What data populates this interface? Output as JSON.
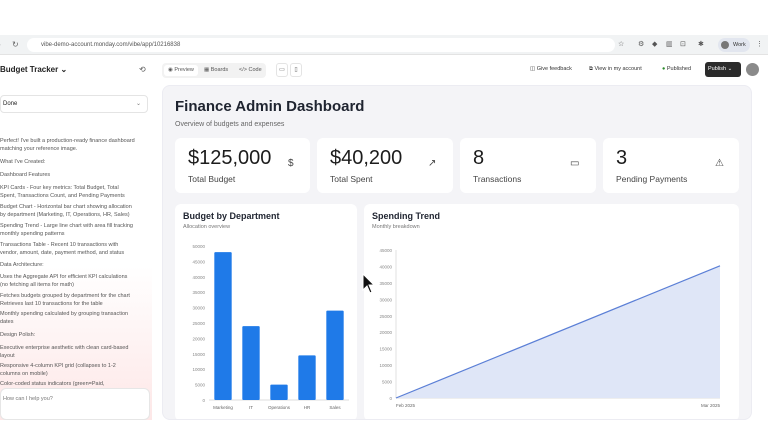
{
  "browser": {
    "url": "vibe-demo-account.monday.com/vibe/app/10216838",
    "profile": "Work"
  },
  "sidebar": {
    "title": "Budget Tracker",
    "status": "Done",
    "lines": [
      "Perfect! I've built a production-ready finance dashboard",
      "matching your reference image.",
      "What I've Created:",
      "Dashboard Features",
      "KPI Cards - Four key metrics: Total Budget, Total",
      "Spent, Transactions Count, and Pending Payments",
      "Budget Chart - Horizontal bar chart showing allocation",
      "by department (Marketing, IT, Operations, HR, Sales)",
      "Spending Trend - Large line chart with area fill tracking",
      "monthly spending patterns",
      "Transactions Table - Recent 10 transactions with",
      "vendor, amount, date, payment method, and status",
      "Data Architecture:",
      "Uses the Aggregate API for efficient KPI calculations",
      "(no fetching all items for math)",
      "Fetches budgets grouped by department for the chart",
      "Retrieves last 10 transactions for the table",
      "Monthly spending calculated by grouping transaction",
      "dates",
      "Design Polish:",
      "Executive enterprise aesthetic with clean card-based",
      "layout",
      "Responsive 4-column KPI grid (collapses to 1-2",
      "columns on mobile)",
      "Color-coded status indicators (green=Paid,"
    ],
    "chat_placeholder": "How can I help you?"
  },
  "toolbar": {
    "tabs": [
      "Preview",
      "Boards",
      "Code"
    ],
    "give_feedback": "Give feedback",
    "view_account": "View in my account",
    "published": "Published",
    "publish": "Publish"
  },
  "dashboard": {
    "title": "Finance Admin Dashboard",
    "subtitle": "Overview of budgets and expenses",
    "kpis": [
      {
        "value": "$125,000",
        "label": "Total Budget",
        "icon": "dollar-icon"
      },
      {
        "value": "$40,200",
        "label": "Total Spent",
        "icon": "trend-up-icon"
      },
      {
        "value": "8",
        "label": "Transactions",
        "icon": "card-icon"
      },
      {
        "value": "3",
        "label": "Pending Payments",
        "icon": "warning-icon"
      }
    ],
    "budget_chart": {
      "title": "Budget by Department",
      "subtitle": "Allocation overview"
    },
    "trend_chart": {
      "title": "Spending Trend",
      "subtitle": "Monthly breakdown"
    }
  },
  "chart_data": [
    {
      "type": "bar",
      "title": "Budget by Department",
      "categories": [
        "Marketing",
        "IT",
        "Operations",
        "HR",
        "Sales"
      ],
      "values": [
        48000,
        24000,
        5000,
        14500,
        29000
      ],
      "ylim": [
        0,
        50000
      ],
      "yticks": [
        "0",
        "5000",
        "10000",
        "15000",
        "20000",
        "25000",
        "30000",
        "35000",
        "40000",
        "45000",
        "50000"
      ],
      "color": "#1f7ae8"
    },
    {
      "type": "area",
      "title": "Spending Trend",
      "categories": [
        "Feb 2025",
        "Mar 2025"
      ],
      "values": [
        0,
        40200
      ],
      "ylim": [
        0,
        45000
      ],
      "yticks": [
        "0",
        "5000",
        "10000",
        "15000",
        "20000",
        "25000",
        "30000",
        "35000",
        "40000",
        "45000"
      ],
      "color": "#5b7fd6"
    }
  ]
}
